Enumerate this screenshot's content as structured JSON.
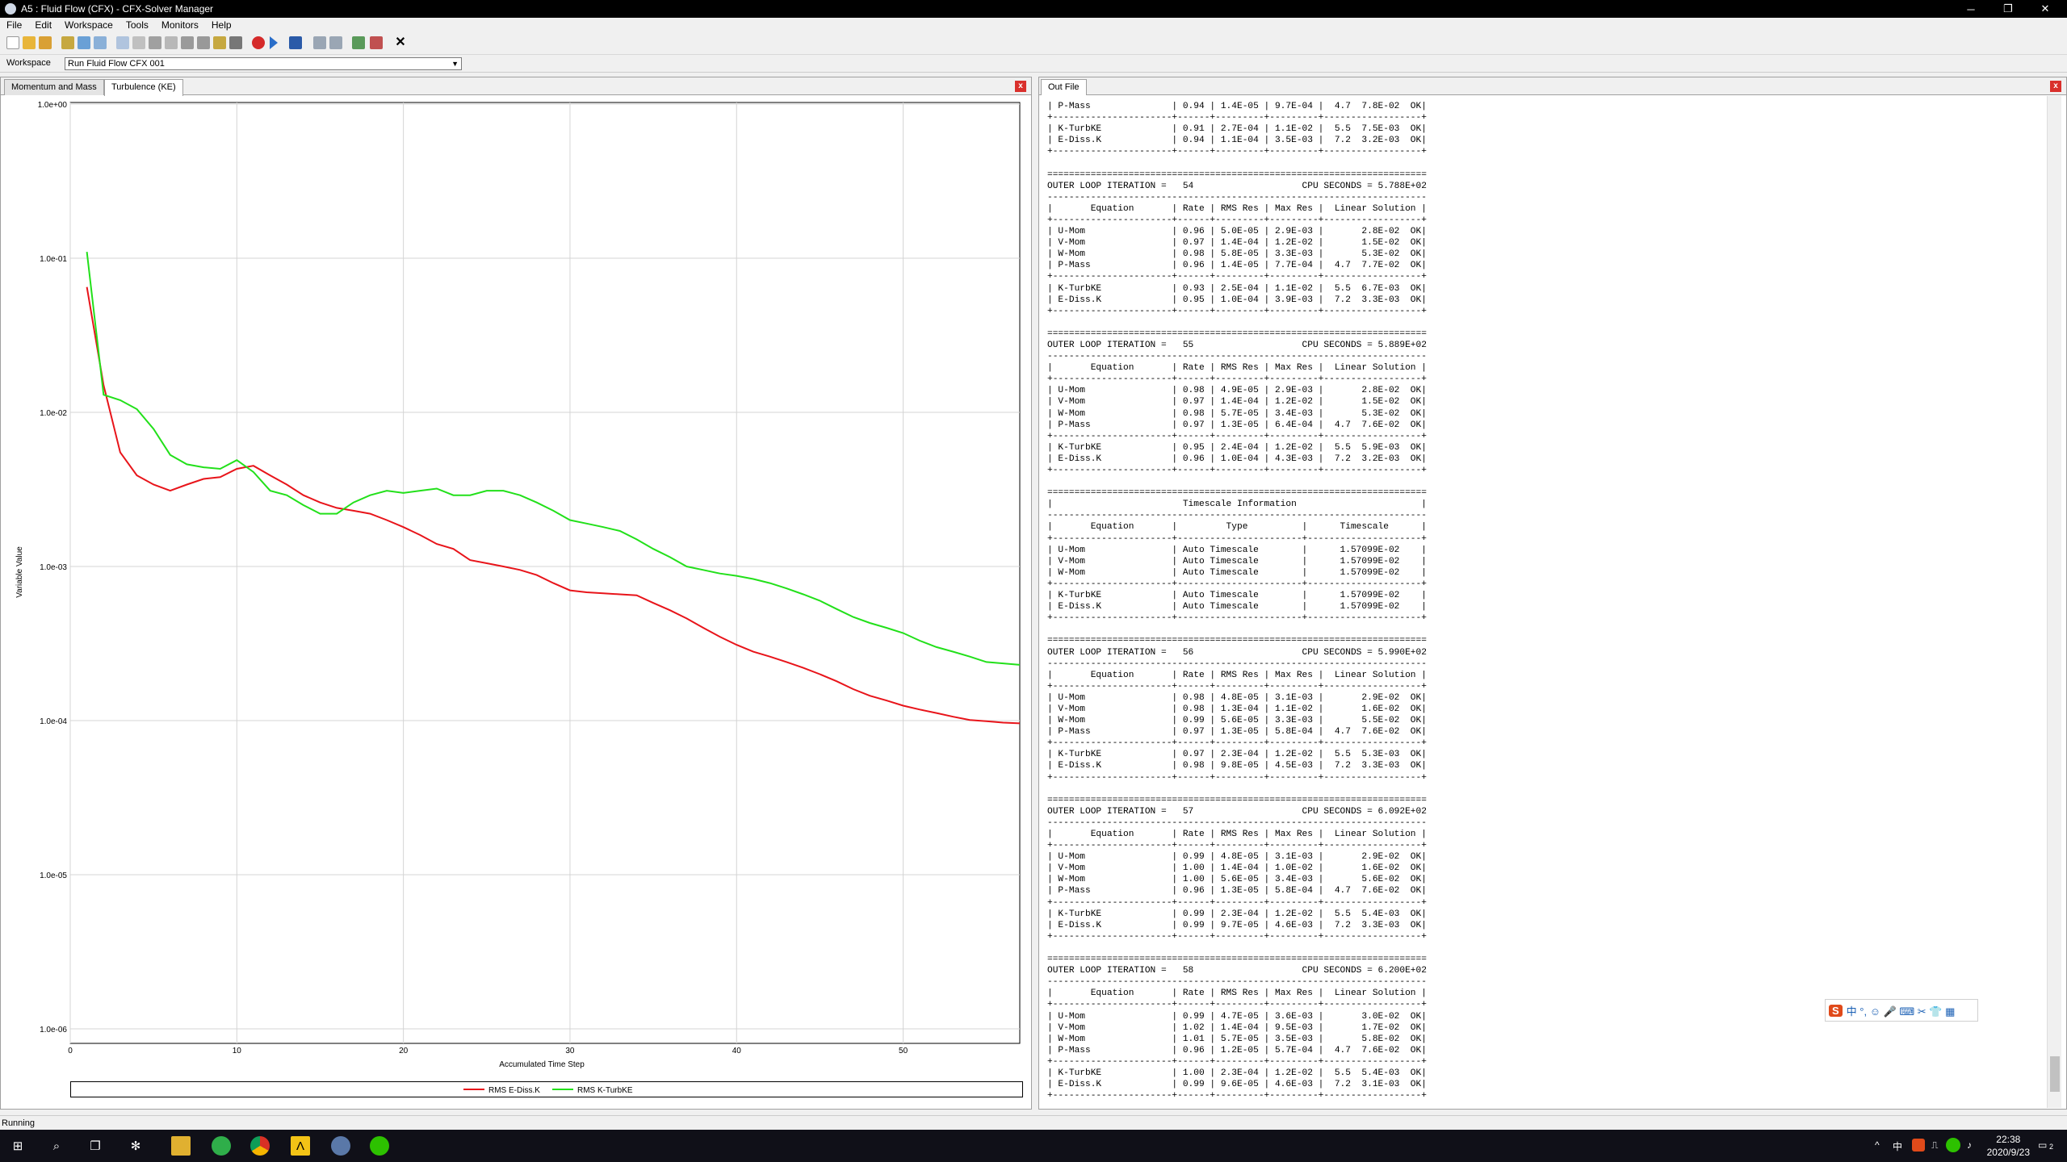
{
  "window": {
    "title": "A5 : Fluid Flow (CFX) - CFX-Solver Manager",
    "minimize": "─",
    "maximize": "❐",
    "close": "✕"
  },
  "menu": [
    "File",
    "Edit",
    "Workspace",
    "Tools",
    "Monitors",
    "Help"
  ],
  "workspace": {
    "label": "Workspace",
    "value": "Run Fluid Flow CFX 001"
  },
  "monitor_tabs": [
    "Momentum and Mass",
    "Turbulence (KE)"
  ],
  "active_tab": "Turbulence (KE)",
  "panel_close": "x",
  "chart_data": {
    "type": "line",
    "title": "",
    "xlabel": "Accumulated Time Step",
    "ylabel": "Variable Value",
    "yscale": "log",
    "xlim": [
      0,
      57
    ],
    "ylim": [
      1e-06,
      1
    ],
    "xticks": [
      "0",
      "10",
      "20",
      "30",
      "40",
      "50"
    ],
    "yticks": [
      "1.0e+00",
      "1.0e-01",
      "1.0e-02",
      "1.0e-03",
      "1.0e-04",
      "1.0e-05",
      "1.0e-06"
    ],
    "grid": true,
    "legend": "bottom",
    "series": [
      {
        "name": "RMS E-Diss.K",
        "color": "#e8141a",
        "x": [
          1,
          2,
          3,
          4,
          5,
          6,
          7,
          8,
          9,
          10,
          11,
          12,
          13,
          14,
          15,
          16,
          17,
          18,
          19,
          20,
          21,
          22,
          23,
          24,
          25,
          26,
          27,
          28,
          29,
          30,
          31,
          32,
          33,
          34,
          35,
          36,
          37,
          38,
          39,
          40,
          41,
          42,
          43,
          44,
          45,
          46,
          47,
          48,
          49,
          50,
          51,
          52,
          53,
          54,
          55,
          56,
          57
        ],
        "y": [
          0.065,
          0.015,
          0.0055,
          0.0039,
          0.0034,
          0.0031,
          0.0034,
          0.0037,
          0.0038,
          0.0043,
          0.0045,
          0.0039,
          0.0034,
          0.0029,
          0.0026,
          0.0024,
          0.0023,
          0.0022,
          0.002,
          0.0018,
          0.0016,
          0.0014,
          0.0013,
          0.0011,
          0.00105,
          0.001,
          0.00095,
          0.00088,
          0.00078,
          0.0007,
          0.00068,
          0.00067,
          0.00066,
          0.00065,
          0.00058,
          0.00052,
          0.00046,
          0.0004,
          0.00035,
          0.00031,
          0.00028,
          0.00026,
          0.00024,
          0.00022,
          0.0002,
          0.00018,
          0.00016,
          0.000145,
          0.000135,
          0.000125,
          0.000118,
          0.000112,
          0.000106,
          0.000101,
          9.9e-05,
          9.7e-05,
          9.6e-05
        ]
      },
      {
        "name": "RMS K-TurbKE",
        "color": "#22e01a",
        "x": [
          1,
          2,
          3,
          4,
          5,
          6,
          7,
          8,
          9,
          10,
          11,
          12,
          13,
          14,
          15,
          16,
          17,
          18,
          19,
          20,
          21,
          22,
          23,
          24,
          25,
          26,
          27,
          28,
          29,
          30,
          31,
          32,
          33,
          34,
          35,
          36,
          37,
          38,
          39,
          40,
          41,
          42,
          43,
          44,
          45,
          46,
          47,
          48,
          49,
          50,
          51,
          52,
          53,
          54,
          55,
          56,
          57
        ],
        "y": [
          0.11,
          0.013,
          0.012,
          0.0105,
          0.0078,
          0.0053,
          0.0046,
          0.0044,
          0.0043,
          0.0049,
          0.0041,
          0.0031,
          0.0029,
          0.0025,
          0.0022,
          0.0022,
          0.0026,
          0.0029,
          0.0031,
          0.003,
          0.0031,
          0.0032,
          0.0029,
          0.0029,
          0.0031,
          0.0031,
          0.0029,
          0.0026,
          0.0023,
          0.002,
          0.0019,
          0.0018,
          0.0017,
          0.0015,
          0.0013,
          0.00115,
          0.001,
          0.00095,
          0.0009,
          0.00087,
          0.00083,
          0.00078,
          0.00072,
          0.00066,
          0.0006,
          0.00053,
          0.00047,
          0.00043,
          0.0004,
          0.00037,
          0.00033,
          0.0003,
          0.00028,
          0.00026,
          0.00024,
          0.000235,
          0.00023
        ]
      }
    ]
  },
  "outfile": {
    "tab": "Out File",
    "lines": [
      "| P-Mass               | 0.94 | 1.4E-05 | 9.7E-04 |  4.7  7.8E-02  OK|",
      "+----------------------+------+---------+---------+------------------+",
      "| K-TurbKE             | 0.91 | 2.7E-04 | 1.1E-02 |  5.5  7.5E-03  OK|",
      "| E-Diss.K             | 0.94 | 1.1E-04 | 3.5E-03 |  7.2  3.2E-03  OK|",
      "+----------------------+------+---------+---------+------------------+",
      "",
      "======================================================================",
      "OUTER LOOP ITERATION =   54                    CPU SECONDS = 5.788E+02",
      "----------------------------------------------------------------------",
      "|       Equation       | Rate | RMS Res | Max Res |  Linear Solution |",
      "+----------------------+------+---------+---------+------------------+",
      "| U-Mom                | 0.96 | 5.0E-05 | 2.9E-03 |       2.8E-02  OK|",
      "| V-Mom                | 0.97 | 1.4E-04 | 1.2E-02 |       1.5E-02  OK|",
      "| W-Mom                | 0.98 | 5.8E-05 | 3.3E-03 |       5.3E-02  OK|",
      "| P-Mass               | 0.96 | 1.4E-05 | 7.7E-04 |  4.7  7.7E-02  OK|",
      "+----------------------+------+---------+---------+------------------+",
      "| K-TurbKE             | 0.93 | 2.5E-04 | 1.1E-02 |  5.5  6.7E-03  OK|",
      "| E-Diss.K             | 0.95 | 1.0E-04 | 3.9E-03 |  7.2  3.3E-03  OK|",
      "+----------------------+------+---------+---------+------------------+",
      "",
      "======================================================================",
      "OUTER LOOP ITERATION =   55                    CPU SECONDS = 5.889E+02",
      "----------------------------------------------------------------------",
      "|       Equation       | Rate | RMS Res | Max Res |  Linear Solution |",
      "+----------------------+------+---------+---------+------------------+",
      "| U-Mom                | 0.98 | 4.9E-05 | 2.9E-03 |       2.8E-02  OK|",
      "| V-Mom                | 0.97 | 1.4E-04 | 1.2E-02 |       1.5E-02  OK|",
      "| W-Mom                | 0.98 | 5.7E-05 | 3.4E-03 |       5.3E-02  OK|",
      "| P-Mass               | 0.97 | 1.3E-05 | 6.4E-04 |  4.7  7.6E-02  OK|",
      "+----------------------+------+---------+---------+------------------+",
      "| K-TurbKE             | 0.95 | 2.4E-04 | 1.2E-02 |  5.5  5.9E-03  OK|",
      "| E-Diss.K             | 0.96 | 1.0E-04 | 4.3E-03 |  7.2  3.2E-03  OK|",
      "+----------------------+------+---------+---------+------------------+",
      "",
      "======================================================================",
      "|                        Timescale Information                       |",
      "----------------------------------------------------------------------",
      "|       Equation       |         Type          |      Timescale      |",
      "+----------------------+-----------------------+---------------------+",
      "| U-Mom                | Auto Timescale        |      1.57099E-02    |",
      "| V-Mom                | Auto Timescale        |      1.57099E-02    |",
      "| W-Mom                | Auto Timescale        |      1.57099E-02    |",
      "+----------------------+-----------------------+---------------------+",
      "| K-TurbKE             | Auto Timescale        |      1.57099E-02    |",
      "| E-Diss.K             | Auto Timescale        |      1.57099E-02    |",
      "+----------------------+-----------------------+---------------------+",
      "",
      "======================================================================",
      "OUTER LOOP ITERATION =   56                    CPU SECONDS = 5.990E+02",
      "----------------------------------------------------------------------",
      "|       Equation       | Rate | RMS Res | Max Res |  Linear Solution |",
      "+----------------------+------+---------+---------+------------------+",
      "| U-Mom                | 0.98 | 4.8E-05 | 3.1E-03 |       2.9E-02  OK|",
      "| V-Mom                | 0.98 | 1.3E-04 | 1.1E-02 |       1.6E-02  OK|",
      "| W-Mom                | 0.99 | 5.6E-05 | 3.3E-03 |       5.5E-02  OK|",
      "| P-Mass               | 0.97 | 1.3E-05 | 5.8E-04 |  4.7  7.6E-02  OK|",
      "+----------------------+------+---------+---------+------------------+",
      "| K-TurbKE             | 0.97 | 2.3E-04 | 1.2E-02 |  5.5  5.3E-03  OK|",
      "| E-Diss.K             | 0.98 | 9.8E-05 | 4.5E-03 |  7.2  3.3E-03  OK|",
      "+----------------------+------+---------+---------+------------------+",
      "",
      "======================================================================",
      "OUTER LOOP ITERATION =   57                    CPU SECONDS = 6.092E+02",
      "----------------------------------------------------------------------",
      "|       Equation       | Rate | RMS Res | Max Res |  Linear Solution |",
      "+----------------------+------+---------+---------+------------------+",
      "| U-Mom                | 0.99 | 4.8E-05 | 3.1E-03 |       2.9E-02  OK|",
      "| V-Mom                | 1.00 | 1.4E-04 | 1.0E-02 |       1.6E-02  OK|",
      "| W-Mom                | 1.00 | 5.6E-05 | 3.4E-03 |       5.6E-02  OK|",
      "| P-Mass               | 0.96 | 1.3E-05 | 5.8E-04 |  4.7  7.6E-02  OK|",
      "+----------------------+------+---------+---------+------------------+",
      "| K-TurbKE             | 0.99 | 2.3E-04 | 1.2E-02 |  5.5  5.4E-03  OK|",
      "| E-Diss.K             | 0.99 | 9.7E-05 | 4.6E-03 |  7.2  3.3E-03  OK|",
      "+----------------------+------+---------+---------+------------------+",
      "",
      "======================================================================",
      "OUTER LOOP ITERATION =   58                    CPU SECONDS = 6.200E+02",
      "----------------------------------------------------------------------",
      "|       Equation       | Rate | RMS Res | Max Res |  Linear Solution |",
      "+----------------------+------+---------+---------+------------------+",
      "| U-Mom                | 0.99 | 4.7E-05 | 3.6E-03 |       3.0E-02  OK|",
      "| V-Mom                | 1.02 | 1.4E-04 | 9.5E-03 |       1.7E-02  OK|",
      "| W-Mom                | 1.01 | 5.7E-05 | 3.5E-03 |       5.8E-02  OK|",
      "| P-Mass               | 0.96 | 1.2E-05 | 5.7E-04 |  4.7  7.6E-02  OK|",
      "+----------------------+------+---------+---------+------------------+",
      "| K-TurbKE             | 1.00 | 2.3E-04 | 1.2E-02 |  5.5  5.4E-03  OK|",
      "| E-Diss.K             | 0.99 | 9.6E-05 | 4.6E-03 |  7.2  3.1E-03  OK|",
      "+----------------------+------+---------+---------+------------------+"
    ]
  },
  "ime": {
    "logo": "S",
    "chars": "中 °, ☺ 🎤 ⌨ ✂ 👕 ▦"
  },
  "status": "Running",
  "taskbar": {
    "time": "22:38",
    "date": "2020/9/23",
    "ime_char": "中",
    "notif": "2"
  },
  "colors": {
    "red": "#e8141a",
    "green": "#22e01a",
    "taskbar": "#101018"
  },
  "icons": [
    "new-file-icon",
    "open-icon",
    "save-icon",
    "stop-icon",
    "play-icon",
    "close-icon",
    "search-icon",
    "windows-start-icon"
  ]
}
